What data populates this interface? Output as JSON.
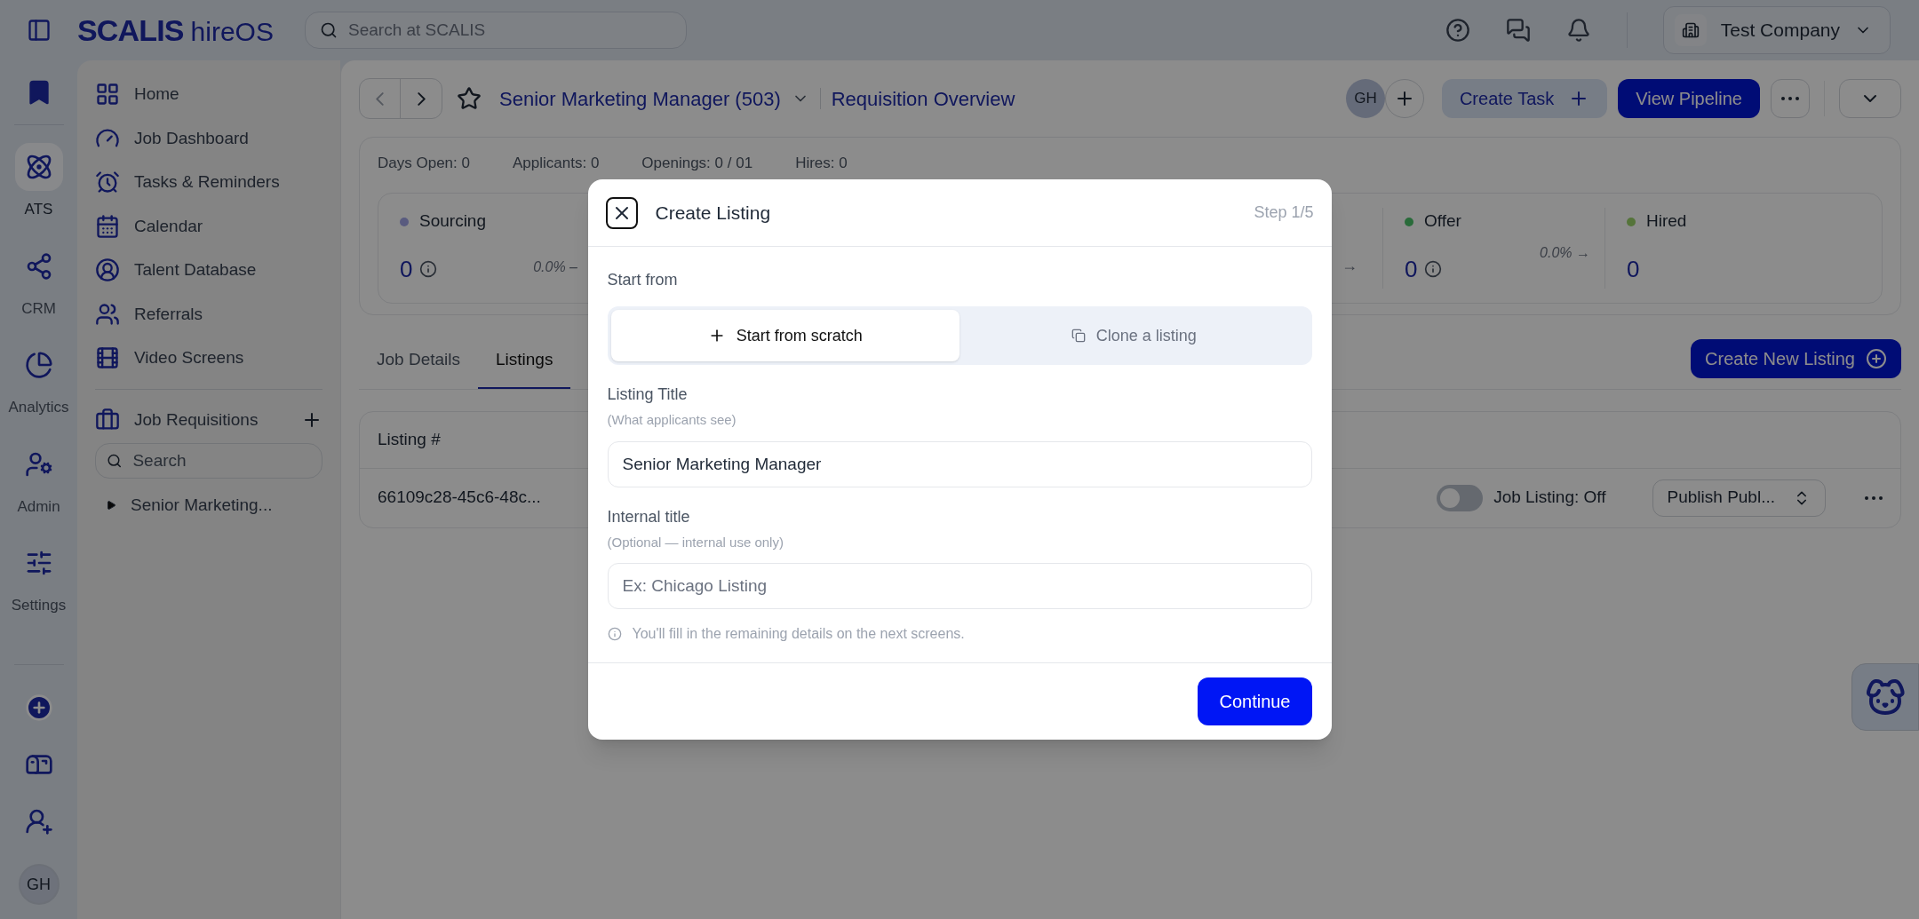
{
  "topbar": {
    "logo": "SCALIS",
    "product": "hireOS",
    "search_placeholder": "Search at SCALIS",
    "company": "Test Company"
  },
  "rail": {
    "items": [
      {
        "label": "ATS",
        "kind": "ats",
        "selected": true
      },
      {
        "label": "CRM",
        "kind": "crm",
        "selected": false
      },
      {
        "label": "Analytics",
        "kind": "analytics",
        "selected": false
      },
      {
        "label": "Admin",
        "kind": "admin",
        "selected": false
      },
      {
        "label": "Settings",
        "kind": "settings",
        "selected": false
      }
    ],
    "avatar": "GH"
  },
  "nav": {
    "items": [
      {
        "label": "Home",
        "kind": "home"
      },
      {
        "label": "Job Dashboard",
        "kind": "dashboard"
      },
      {
        "label": "Tasks & Reminders",
        "kind": "tasks"
      },
      {
        "label": "Calendar",
        "kind": "calendar"
      },
      {
        "label": "Talent Database",
        "kind": "talent"
      },
      {
        "label": "Referrals",
        "kind": "referrals"
      },
      {
        "label": "Video Screens",
        "kind": "video"
      }
    ],
    "section": "Job Requisitions",
    "search_placeholder": "Search",
    "tree": [
      {
        "label": "Senior Marketing...",
        "expanded": false
      }
    ]
  },
  "header": {
    "title": "Senior Marketing Manager (503)",
    "subtitle": "Requisition Overview",
    "avatar": "GH",
    "create_task": "Create Task",
    "view_pipeline": "View Pipeline"
  },
  "stats": [
    {
      "label": "Days Open:",
      "value": "0"
    },
    {
      "label": "Applicants:",
      "value": "0"
    },
    {
      "label": "Openings:",
      "value": "0 / 01"
    },
    {
      "label": "Hires:",
      "value": "0"
    }
  ],
  "stages": [
    {
      "name": "Sourcing",
      "kind": "sourcing",
      "count": "0",
      "rate": "0.0% –"
    },
    {
      "name": "Offer",
      "kind": "offer",
      "count": "0",
      "incoming_arrow": "→",
      "rate": "0.0% →"
    },
    {
      "name": "Hired",
      "kind": "hired",
      "count": "0"
    }
  ],
  "tabs": [
    {
      "label": "Job Details",
      "selected": false
    },
    {
      "label": "Listings",
      "selected": true
    }
  ],
  "create_listing": "Create New Listing",
  "table": {
    "columns": [
      "Listing #"
    ],
    "rows": [
      {
        "cells": [
          "66109c28-45c6-48c..."
        ],
        "toggle": {
          "label": "Job Listing: Off",
          "on": false
        },
        "publish": "Publish Publ..."
      }
    ]
  },
  "modal": {
    "title": "Create Listing",
    "step": "Step 1/5",
    "start_label": "Start from",
    "options": [
      {
        "label": "Start from scratch",
        "kind": "plus",
        "selected": true
      },
      {
        "label": "Clone a listing",
        "kind": "copy",
        "selected": false
      }
    ],
    "fields": [
      {
        "label": "Listing Title",
        "hint": "(What applicants see)",
        "value": "Senior Marketing Manager"
      },
      {
        "label": "Internal title",
        "hint": "(Optional — internal use only)",
        "placeholder": "Ex: Chicago Listing"
      }
    ],
    "note": "You'll fill in the remaining details on the next screens.",
    "primary": "Continue"
  }
}
